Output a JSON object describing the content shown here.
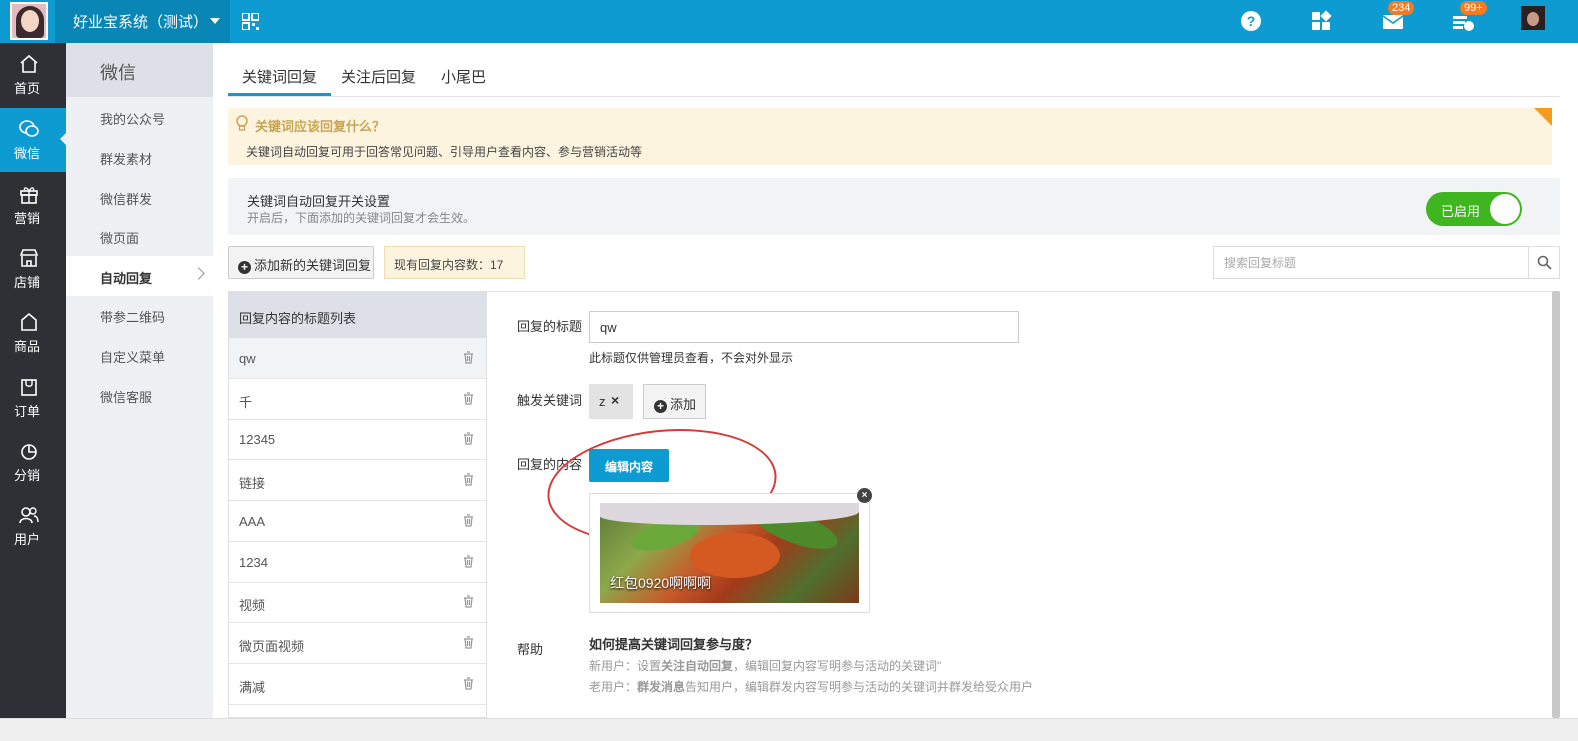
{
  "topbar": {
    "system_title": "好业宝系统（测试）",
    "mail_badge": "234",
    "notice_badge": "99+"
  },
  "leftnav": [
    {
      "label": "首页",
      "icon": "home-icon"
    },
    {
      "label": "微信",
      "icon": "wechat-icon",
      "active": true
    },
    {
      "label": "营销",
      "icon": "gift-icon"
    },
    {
      "label": "店铺",
      "icon": "store-icon"
    },
    {
      "label": "商品",
      "icon": "product-icon"
    },
    {
      "label": "订单",
      "icon": "order-icon"
    },
    {
      "label": "分销",
      "icon": "pie-icon"
    },
    {
      "label": "用户",
      "icon": "users-icon"
    }
  ],
  "subnav": {
    "title": "微信",
    "items": [
      "我的公众号",
      "群发素材",
      "微信群发",
      "微页面",
      "自动回复",
      "带参二维码",
      "自定义菜单",
      "微信客服"
    ],
    "active_index": 4
  },
  "tabs": [
    "关键词回复",
    "关注后回复",
    "小尾巴"
  ],
  "tip": {
    "title": "关键词应该回复什么？",
    "text": "关键词自动回复可用于回答常见问题、引导用户查看内容、参与营销活动等"
  },
  "switch": {
    "title": "关键词自动回复开关设置",
    "sub": "开启后，下面添加的关键词回复才会生效。",
    "state_label": "已启用"
  },
  "toolbar": {
    "add_label": "添加新的关键词回复",
    "count_label": "现有回复内容数：17",
    "search_placeholder": "搜索回复标题"
  },
  "list": {
    "header": "回复内容的标题列表",
    "rows": [
      "qw",
      "千",
      "12345",
      "链接",
      "AAA",
      "1234",
      "视频",
      "微页面视频",
      "满减"
    ]
  },
  "detail": {
    "title_label": "回复的标题",
    "title_value": "qw",
    "title_hint": "此标题仅供管理员查看，不会对外显示",
    "keyword_label": "触发关键词",
    "keyword_tag": "z",
    "keyword_add": "添加",
    "content_label": "回复的内容",
    "edit_button": "编辑内容",
    "media_caption": "红包0920啊啊啊",
    "help_label": "帮助",
    "help_title": "如何提高关键词回复参与度？",
    "help_new_prefix": "新用户：设置",
    "help_new_bold": "关注自动回复",
    "help_new_suffix": "，编辑回复内容写明参与活动的关键词\"",
    "help_old_prefix": "老用户：",
    "help_old_bold": "群发消息",
    "help_old_suffix": "告知用户，编辑群发内容写明参与活动的关键词并群发给受众用户"
  },
  "colors": {
    "primary": "#0e9bd1",
    "nav_dark": "#2e3036",
    "toggle_on": "#3fb61f",
    "tip_bg": "#fdf4e0",
    "highlight": "#d63a3a"
  }
}
